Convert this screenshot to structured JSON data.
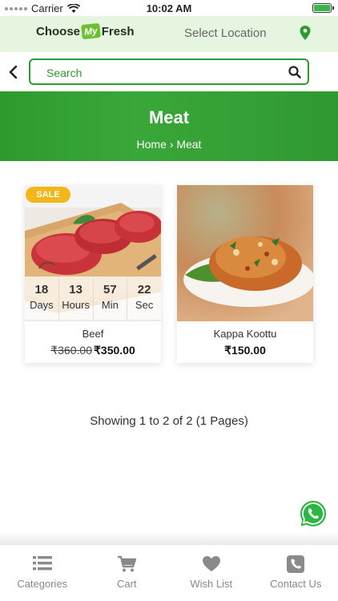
{
  "status_bar": {
    "carrier": "Carrier",
    "time": "10:02 AM"
  },
  "header": {
    "logo": {
      "part1": "Choose",
      "part2": "My",
      "part3": "Fresh"
    },
    "select_location": "Select Location",
    "icons": {
      "location": "map-pin-icon"
    }
  },
  "search": {
    "placeholder": "Search",
    "icon": "search-icon"
  },
  "banner": {
    "title": "Meat",
    "breadcrumb": "Home › Meat"
  },
  "products": [
    {
      "badge": "SALE",
      "name": "Beef",
      "old_price": "₹360.00",
      "price": "₹350.00",
      "countdown": [
        {
          "value": "18",
          "unit": "Days"
        },
        {
          "value": "13",
          "unit": "Hours"
        },
        {
          "value": "57",
          "unit": "Min"
        },
        {
          "value": "22",
          "unit": "Sec"
        }
      ]
    },
    {
      "name": "Kappa Koottu",
      "price": "₹150.00"
    }
  ],
  "pagination": {
    "text": "Showing 1 to 2 of 2 (1 Pages)"
  },
  "bottom_nav": [
    {
      "label": "Categories",
      "icon": "list-icon"
    },
    {
      "label": "Cart",
      "icon": "cart-icon"
    },
    {
      "label": "Wish List",
      "icon": "heart-icon"
    },
    {
      "label": "Contact Us",
      "icon": "phone-icon"
    }
  ],
  "colors": {
    "brand_green": "#2f9a2f",
    "header_bg": "#e5f5e0",
    "sale_badge": "#f2b51a"
  }
}
